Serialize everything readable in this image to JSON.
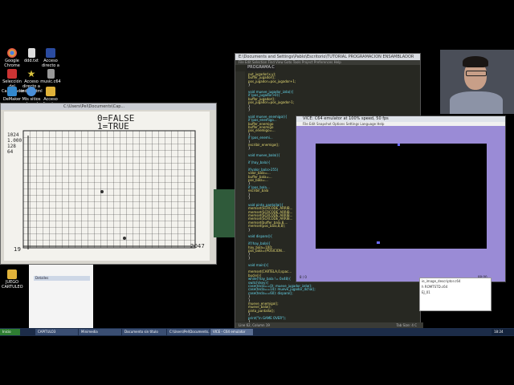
{
  "desktop": {
    "icons": [
      {
        "label": "Google Chrome",
        "color": "#e8b03a"
      },
      {
        "label": "ddd.txt",
        "color": "#cccccc"
      },
      {
        "label": "Acceso directo a",
        "color": "#2a4ba0"
      },
      {
        "label": "Selección del Capturador",
        "color": "#cc3333"
      },
      {
        "label": "Acceso directo a index.html",
        "color": "#d9c23d"
      },
      {
        "label": "music.c64",
        "color": "#999999"
      },
      {
        "label": "DeMaker",
        "color": "#3388cc"
      },
      {
        "label": "Mis sitios de red",
        "color": "#4a8fd8"
      },
      {
        "label": "Acceso directo a casseta",
        "color": "#e0b23a"
      },
      {
        "label": "JUEGO CARTULEO",
        "color": "#e0b23a"
      }
    ]
  },
  "photo_window": {
    "title": "C:\\Users\\Pel\\Documents\\Cap...",
    "notes": {
      "line1": "0=FALSE",
      "line2": "1=TRUE",
      "left_label": "1024\n1.000\n128\n64",
      "bottom_left": "19",
      "bottom_right": "2047"
    }
  },
  "editor": {
    "title": "E:\\Documents and Settings\\Pablo\\Escritorio\\TUTORIAL PROGRAMACION ENSAMBLADOR",
    "menu": "File Edit Selection Find View Goto Tools Project Preferences Help",
    "tab": "PROGRAMA.C",
    "status": "Line 62, Column 19",
    "status_right": "Tab Size: 4   C",
    "lines": [
      "put_jugador(x,y);",
      "buffer_jugador();",
      "pos_jugador=pos_jugador+1;",
      "}",
      "",
      "void mueve_jugador_izda(){",
      "  if (pos_jugador>0){",
      "    buffer_jugador();",
      "    pos_jugador=pos_jugador-1;",
      "  }",
      "}",
      "",
      "void mueve_enemigo(){",
      "  if (pos_enemigo...",
      "    buffer_enemigo",
      "    buffer_enemigo",
      "    pos_enemigo=...",
      "  }",
      "  if (pos_enemi...",
      "  }",
      "  escribir_enemigo();",
      "}",
      "",
      "void mueve_bala(){",
      "",
      "  if (hay_bala){",
      "",
      "    if(valor_bala>255)",
      "      valor_bala=...",
      "      buffer_bala=...",
      "      pos_bala=...",
      "    }",
      "    if (pos_bala...",
      "    escribir_bala",
      "  }",
      "}",
      "",
      "void pinta_pantalla(){",
      "  memset(SCRCODE_ARRIB...",
      "  memset(SCRCODE_ARRIB...",
      "  memset(SCRCODE_ARRIB...",
      "  memset(SCRCODE_ARRIB...",
      "  memset(buffer_bala,8,...",
      "  memset(pos_bala,8,8);",
      "}",
      "",
      "void disparo(){",
      "",
      "  if(!hay_bala){",
      "    hay_bala=100;",
      "    pos_bala=(POSICION...",
      "  }",
      "}",
      "",
      "void main(){",
      "",
      "  memset(CARTELA,0,spac...",
      "  bucle(){",
      "  while(!hay_bala != 0x48){",
      "    switch(key){",
      "      case(tecla==0): mueve_jugador_izda();",
      "      case(tecla==14): mueve_jugador_dcha();",
      "      case(tecla==60): disparo();",
      "    }",
      "  }",
      "  mueve_enemigo();",
      "  mueve_bala();",
      "  pinta_pantalla();",
      "  }",
      "  print(\"\\n GAME OVER\");",
      "}"
    ]
  },
  "vice": {
    "title": "VICE: C64 emulator at 100% speed, 50 fps",
    "menu": "File Edit Snapshot Options Settings Language Help",
    "status_left": "8 / 0",
    "status_right": "88:00"
  },
  "small_window": {
    "label": "Detalles"
  },
  "right_panel": {
    "line1": "ie_image_descriptor.c64",
    "line2": "h ROMTSTD.c64",
    "line3": "",
    "line4": "EJ_01"
  },
  "taskbar": {
    "start": "Inicio",
    "buttons": [
      "CAPITULO3",
      "Minimedia",
      "Documento sin título",
      "C:\\Users\\Pel\\Documents...",
      "VICE - C64 emulator"
    ],
    "clock": "18:24"
  },
  "colors": {
    "editor_bg": "#272822",
    "vice_border": "#9a8bd6",
    "c64_screen": "#000000",
    "taskbar": "#1c2c48"
  }
}
